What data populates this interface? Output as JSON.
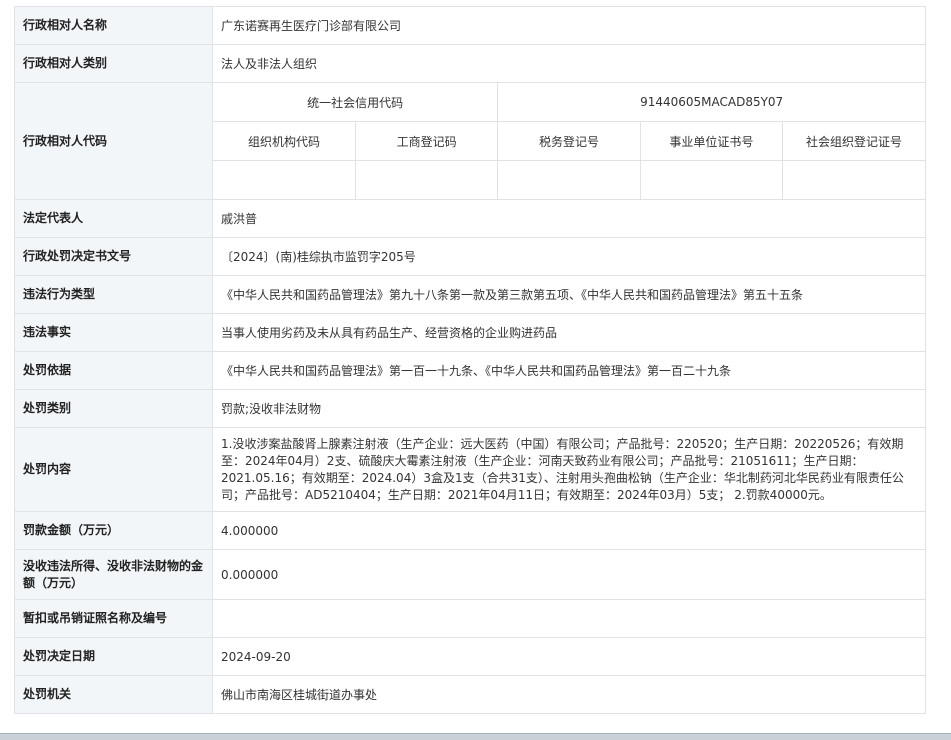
{
  "rows": {
    "name": {
      "label": "行政相对人名称",
      "value": "广东诺赛再生医疗门诊部有限公司"
    },
    "category": {
      "label": "行政相对人类别",
      "value": "法人及非法人组织"
    },
    "code": {
      "label": "行政相对人代码",
      "credit_label": "统一社会信用代码",
      "credit_value": "91440605MACAD85Y07",
      "sub_headers": [
        "组织机构代码",
        "工商登记码",
        "税务登记号",
        "事业单位证书号",
        "社会组织登记证号"
      ]
    },
    "legal_rep": {
      "label": "法定代表人",
      "value": "戚洪普"
    },
    "doc_no": {
      "label": "行政处罚决定书文号",
      "value": "〔2024〕(南)桂综执市监罚字205号"
    },
    "violation_type": {
      "label": "违法行为类型",
      "value": "《中华人民共和国药品管理法》第九十八条第一款及第三款第五项、《中华人民共和国药品管理法》第五十五条"
    },
    "facts": {
      "label": "违法事实",
      "value": "当事人使用劣药及未从具有药品生产、经营资格的企业购进药品"
    },
    "basis": {
      "label": "处罚依据",
      "value": "《中华人民共和国药品管理法》第一百一十九条、《中华人民共和国药品管理法》第一百二十九条"
    },
    "penalty_type": {
      "label": "处罚类别",
      "value": "罚款;没收非法财物"
    },
    "penalty_content": {
      "label": "处罚内容",
      "value": "1.没收涉案盐酸肾上腺素注射液（生产企业：远大医药（中国）有限公司；产品批号：220520；生产日期：20220526；有效期至：2024年04月）2支、硫酸庆大霉素注射液（生产企业：河南天致药业有限公司；产品批号：21051611；生产日期：2021.05.16；有效期至：2024.04）3盒及1支（合共31支）、注射用头孢曲松钠（生产企业：华北制药河北华民药业有限责任公司；产品批号：AD5210404；生产日期：2021年04月11日；有效期至：2024年03月）5支； 2.罚款40000元。"
    },
    "fine": {
      "label": "罚款金额（万元）",
      "value": "4.000000"
    },
    "confiscation": {
      "label": "没收违法所得、没收非法财物的金额（万元）",
      "value": "0.000000"
    },
    "license": {
      "label": "暂扣或吊销证照名称及编号",
      "value": ""
    },
    "date": {
      "label": "处罚决定日期",
      "value": "2024-09-20"
    },
    "authority": {
      "label": "处罚机关",
      "value": "佛山市南海区桂城街道办事处"
    }
  }
}
